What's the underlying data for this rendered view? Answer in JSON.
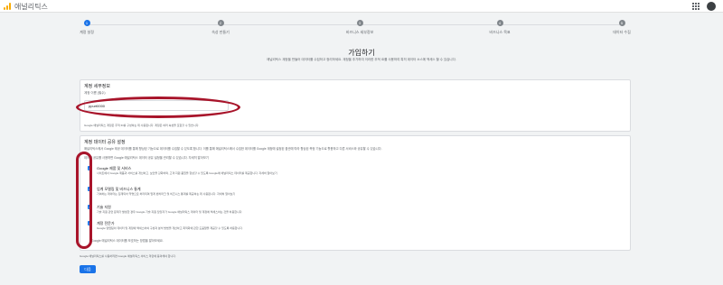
{
  "app": {
    "title": "애널리틱스"
  },
  "steps": [
    {
      "num": "1",
      "label": "계정 설정"
    },
    {
      "num": "2",
      "label": "속성 만들기"
    },
    {
      "num": "3",
      "label": "비즈니스 세부정보"
    },
    {
      "num": "4",
      "label": "비즈니스 목표"
    },
    {
      "num": "5",
      "label": "데이터 수집"
    }
  ],
  "main": {
    "heading": "가입하기",
    "subtext": "애널리틱스 계정을 만들어 데이터를 수집하고 정리하세요. 계정을 추가하여 이러한 추적 ID를 사용하여 특히 데이터 소스에 액세스 할 수 있습니다."
  },
  "account_details": {
    "title": "계정 세부정보",
    "field_label": "계정 이름 (필수)",
    "field_value": "ppurt0000",
    "hint": "Google 애널리틱스 계정은 추적 ID를 구성하는 데 사용됩니다. 계정은 여러 속성을 포함할 수 있습니다."
  },
  "data_sharing": {
    "title": "계정 데이터 공유 설정",
    "desc1": "애널리틱스에서 Google 제공 데이터를 통해 향상된 기능으로 데이터를 수집할 수 있도록 합니다. 이를 통해 애널리틱스에서 수집한 데이터를 Google 계정에 설정된 옵션에 따라 향상된 측정 기능으로 활용하고 다른 서비스와 공유할 수 있습니다.",
    "desc2": "데이터 공유를 사용하면 Google 애널리틱스 데이터 공유 설정을 관리할 수 있습니다. 자세히 알아보기",
    "options": [
      {
        "title": "Google 제품 및 서비스",
        "desc": "사이트에서 Google 제품과 서비스를 개선하고, 보안을 강화하며, 고객 지원 품질을 향상할 수 있도록 Google에 애널리틱스 데이터를 제공합니다. 자세히 알아보기"
      },
      {
        "title": "업계 모델링 및 비즈니스 통계",
        "desc": "기여하는 데이터는 집계되어 익명으로 처리되며 업계 벤치마크 및 비즈니스 통계를 제공하는 데 사용됩니다. 자세히 알아보기"
      },
      {
        "title": "기술 지원",
        "desc": "기술 지원 관련 문제가 발생한 경우 Google 기술 지원 담당자가 Google 애널리틱스 데이터 및 계정에 액세스하는 것을 허용합니다."
      },
      {
        "title": "계정 전문가",
        "desc": "Google 영업팀이 데이터 및 계정에 액세스하여 구성과 분석 방법을 개선하고 최적화에 관한 도움말을 제공할 수 있도록 허용합니다."
      }
    ],
    "footer_note": "Google 애널리틱스 데이터를 보호하는 방법을 알아보세요."
  },
  "footer": {
    "terms": "Google 애널리틱스를 사용하려면 Google 애널리틱스 서비스 약관에 동의해야 합니다.",
    "next_label": "다음"
  }
}
